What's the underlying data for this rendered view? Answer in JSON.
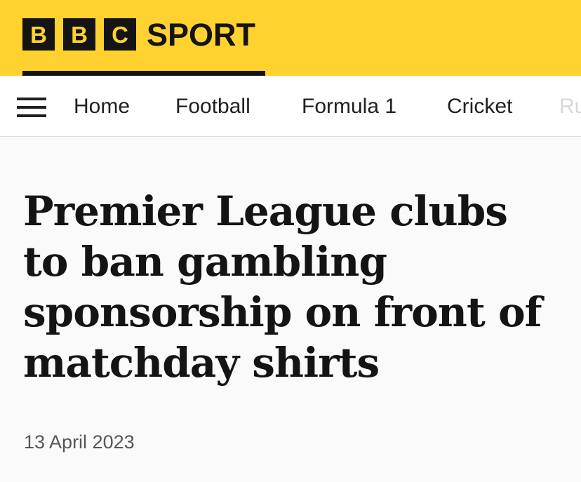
{
  "brand": {
    "letters": [
      "B",
      "B",
      "C"
    ],
    "sport": "SPORT",
    "colors": {
      "header_bg": "#ffd230",
      "logo_box": "#141414",
      "text_dark": "#141414"
    }
  },
  "nav": {
    "menu_icon": "hamburger-menu-icon",
    "items": [
      {
        "label": "Home"
      },
      {
        "label": "Football"
      },
      {
        "label": "Formula 1"
      },
      {
        "label": "Cricket"
      },
      {
        "label": "Ru"
      }
    ]
  },
  "article": {
    "headline": "Premier League clubs to ban gambling sponsorship on front of matchday shirts",
    "date": "13 April 2023"
  }
}
